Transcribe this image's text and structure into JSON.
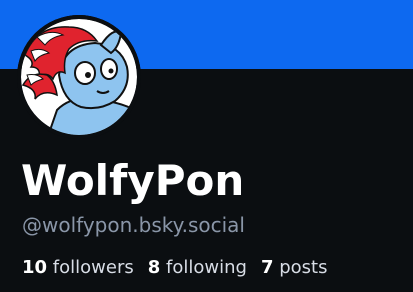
{
  "profile": {
    "display_name": "WolfyPon",
    "handle": "@wolfypon.bsky.social",
    "avatar_icon": "pony-avatar-icon"
  },
  "banner": {
    "color": "#0d69f0"
  },
  "stats": {
    "followers_count": "10",
    "followers_label": "followers",
    "following_count": "8",
    "following_label": "following",
    "posts_count": "7",
    "posts_label": "posts"
  }
}
